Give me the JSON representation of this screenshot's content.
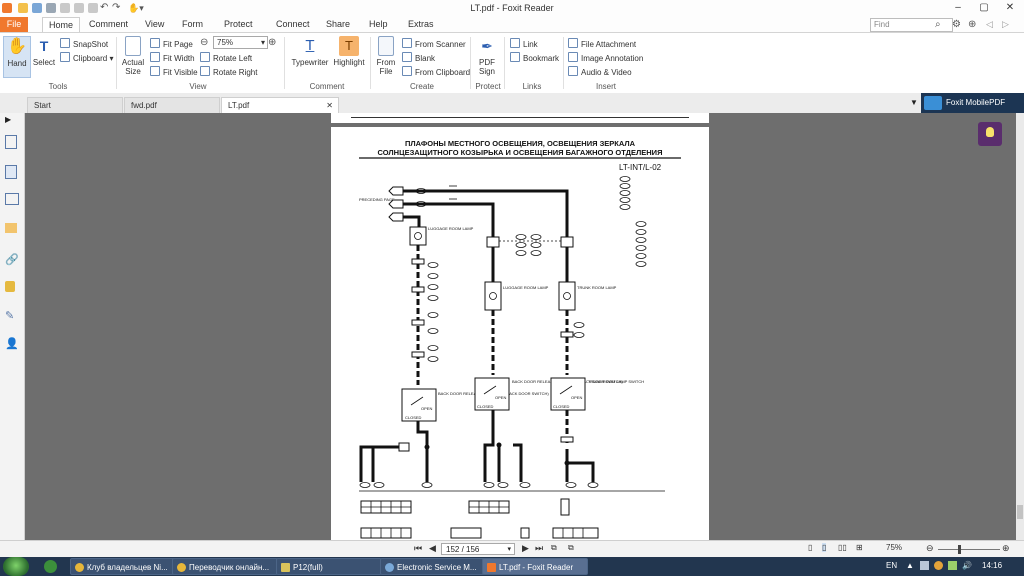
{
  "window": {
    "title": "LT.pdf - Foxit Reader"
  },
  "menu": {
    "tabs": [
      "File",
      "Home",
      "Comment",
      "View",
      "Form",
      "Protect",
      "Connect",
      "Share",
      "Help",
      "Extras"
    ],
    "search_placeholder": "Find"
  },
  "ribbon": {
    "tools": {
      "hand": "Hand",
      "select": "Select",
      "snapshot": "SnapShot",
      "clipboard": "Clipboard",
      "group": "Tools"
    },
    "view": {
      "actual_size_1": "Actual",
      "actual_size_2": "Size",
      "fit_page": "Fit Page",
      "fit_width": "Fit Width",
      "fit_visible": "Fit Visible",
      "zoom": "75%",
      "rotate_left": "Rotate Left",
      "rotate_right": "Rotate Right",
      "group": "View"
    },
    "comment": {
      "typewriter": "Typewriter",
      "highlight": "Highlight",
      "group": "Comment"
    },
    "create": {
      "from_file_1": "From",
      "from_file_2": "File",
      "from_scanner": "From Scanner",
      "blank": "Blank",
      "from_clipboard": "From Clipboard",
      "group": "Create"
    },
    "protect": {
      "pdf_sign_1": "PDF",
      "pdf_sign_2": "Sign",
      "group": "Protect"
    },
    "links": {
      "link": "Link",
      "bookmark": "Bookmark",
      "group": "Links"
    },
    "insert": {
      "file_attachment": "File Attachment",
      "image_annotation": "Image Annotation",
      "audio_video": "Audio & Video",
      "group": "Insert"
    }
  },
  "doc_tabs": [
    "Start",
    "fwd.pdf",
    "LT.pdf"
  ],
  "foxit_mobile": "Foxit MobilePDF",
  "document": {
    "heading_line1": "ПЛАФОНЫ МЕСТНОГО ОСВЕЩЕНИЯ, ОСВЕЩЕНИЯ ЗЕРКАЛА",
    "heading_line2": "СОЛНЦЕЗАЩИТНОГО КОЗЫРЬКА И ОСВЕЩЕНИЯ БАГАЖНОГО ОТДЕЛЕНИЯ",
    "code": "LT-INT/L-02",
    "labels": {
      "preceding": "PRECEDING PAGE",
      "luggage1": "LUGGAGE ROOM LAMP",
      "luggage2": "LUGGAGE ROOM LAMP",
      "trunk": "TRUNK ROOM LAMP",
      "backdoor1": "BACK DOOR RELEASE ACTUATOR (BACK DOOR SWITCH)",
      "backdoor2": "BACK DOOR RELEASE ACTUATOR (BACK DOOR SWITCH)",
      "trunkswitch": "TRUNK ROOM LAMP SWITCH",
      "open1": "OPEN",
      "closed1": "CLOSED",
      "open2": "OPEN",
      "closed2": "CLOSED",
      "open3": "OPEN",
      "closed3": "CLOSED"
    }
  },
  "status": {
    "page": "152 / 156",
    "zoom": "75%"
  },
  "taskbar": {
    "items": [
      "Клуб владельцев Ni...",
      "Переводчик онлайн...",
      "P12(full)",
      "Electronic Service M...",
      "LT.pdf - Foxit Reader"
    ],
    "lang": "EN",
    "time": "14:16"
  }
}
